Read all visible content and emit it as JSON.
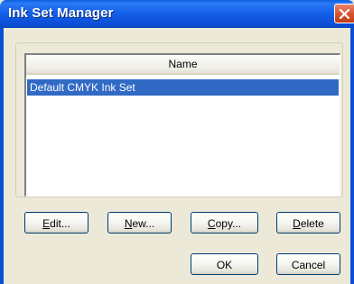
{
  "window": {
    "title": "Ink Set Manager"
  },
  "list": {
    "column_header": "Name",
    "items": [
      {
        "label": "Default CMYK Ink Set",
        "selected": true
      }
    ]
  },
  "buttons": {
    "edit": {
      "mnemonic": "E",
      "rest": "dit..."
    },
    "new": {
      "mnemonic": "N",
      "rest": "ew..."
    },
    "copy": {
      "mnemonic": "C",
      "rest": "opy..."
    },
    "delete": {
      "mnemonic": "D",
      "rest": "elete"
    },
    "ok": "OK",
    "cancel": "Cancel"
  },
  "colors": {
    "titlebar": "#0b4fd6",
    "selection": "#316ac5",
    "dialog_bg": "#ece9d8",
    "close": "#d8512d"
  }
}
